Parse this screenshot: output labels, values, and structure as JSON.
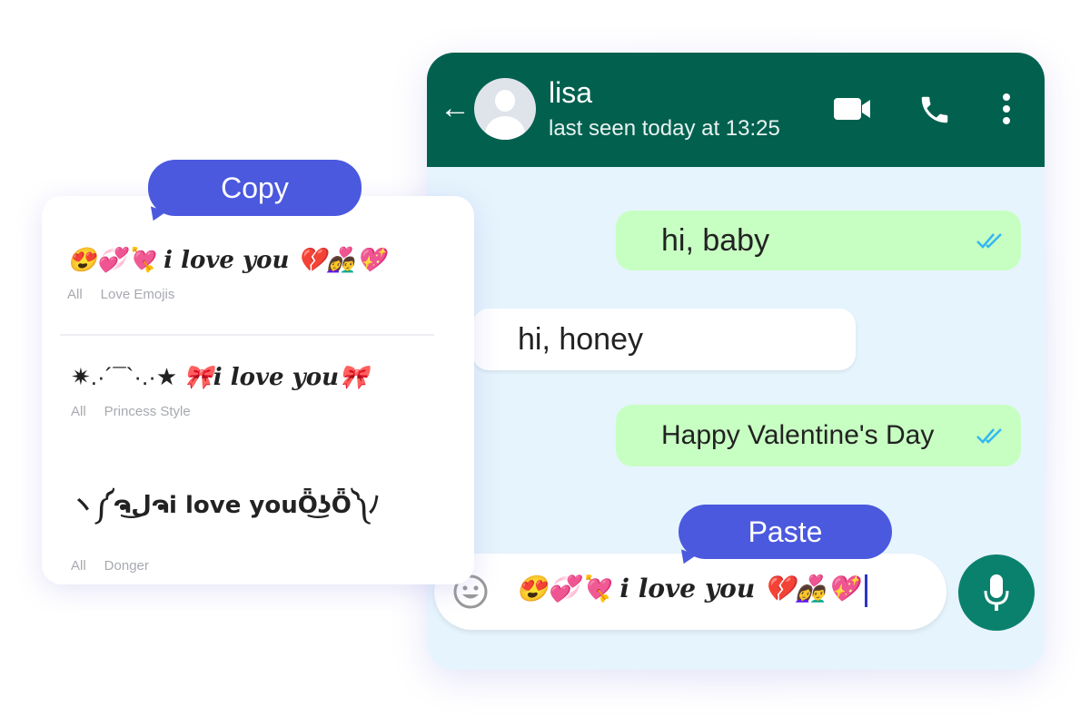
{
  "chat": {
    "contact_name": "lisa",
    "status": "last seen today at 13:25",
    "messages": [
      {
        "text": "hi, baby",
        "direction": "out"
      },
      {
        "text": "hi, honey",
        "direction": "in"
      },
      {
        "text": "Happy Valentine's Day",
        "direction": "out"
      }
    ],
    "input_value": "😍💞💘 i love you 💔👩‍❤️‍👨💖",
    "icons": [
      "back-arrow-icon",
      "avatar-icon",
      "video-camera-icon",
      "phone-icon",
      "more-vertical-icon",
      "emoji-icon",
      "microphone-icon",
      "double-check-icon"
    ]
  },
  "copy_panel": {
    "items": [
      {
        "text": "😍💞💘 i love you 💔👩‍❤️‍👨💖",
        "tags": [
          "All",
          "Love Emojis"
        ]
      },
      {
        "prefix": "✷.·´¯`·.·★ ",
        "text": "🎀i love you🎀",
        "tags": [
          "All",
          "Princess Style"
        ]
      },
      {
        "text": "ヽ༼ຈل͜ຈi love youȪ͜ʖȪ༽ﾉ",
        "tags": [
          "All",
          "Donger"
        ]
      }
    ]
  },
  "callouts": {
    "copy": "Copy",
    "paste": "Paste"
  },
  "colors": {
    "header": "#02604f",
    "outgoing": "#c7ffc2",
    "callout": "#4b59de",
    "mic": "#09816d",
    "tick": "#34b7f1"
  }
}
